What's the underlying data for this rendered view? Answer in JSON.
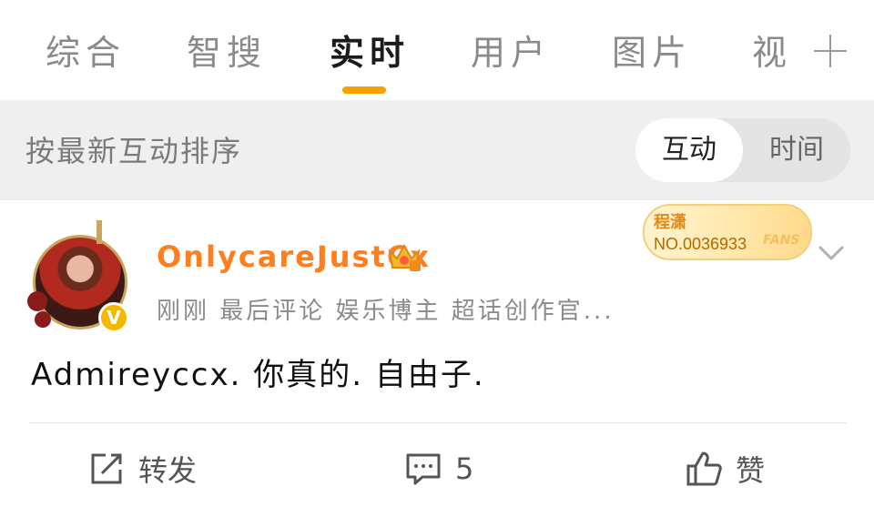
{
  "tabs": {
    "items": [
      {
        "label": "综合"
      },
      {
        "label": "智搜"
      },
      {
        "label": "实时"
      },
      {
        "label": "用户"
      },
      {
        "label": "图片"
      },
      {
        "label": "视"
      }
    ],
    "active_index": 2,
    "accent_color": "#f5a100"
  },
  "sortbar": {
    "label": "按最新互动排序",
    "toggle": {
      "selected": "互动",
      "other": "时间"
    }
  },
  "post": {
    "username": "OnlycareJustCx",
    "meta": "刚刚 最后评论  娱乐博主 超话创作官...",
    "fans_card": {
      "name": "程潇",
      "number": "NO.0036933",
      "tag": "FANS"
    },
    "content": "Admireyccx. 你真的. 自由子.",
    "username_color": "#ff7f1e"
  },
  "actions": {
    "repost": "转发",
    "comment_count": "5",
    "like": "赞"
  }
}
